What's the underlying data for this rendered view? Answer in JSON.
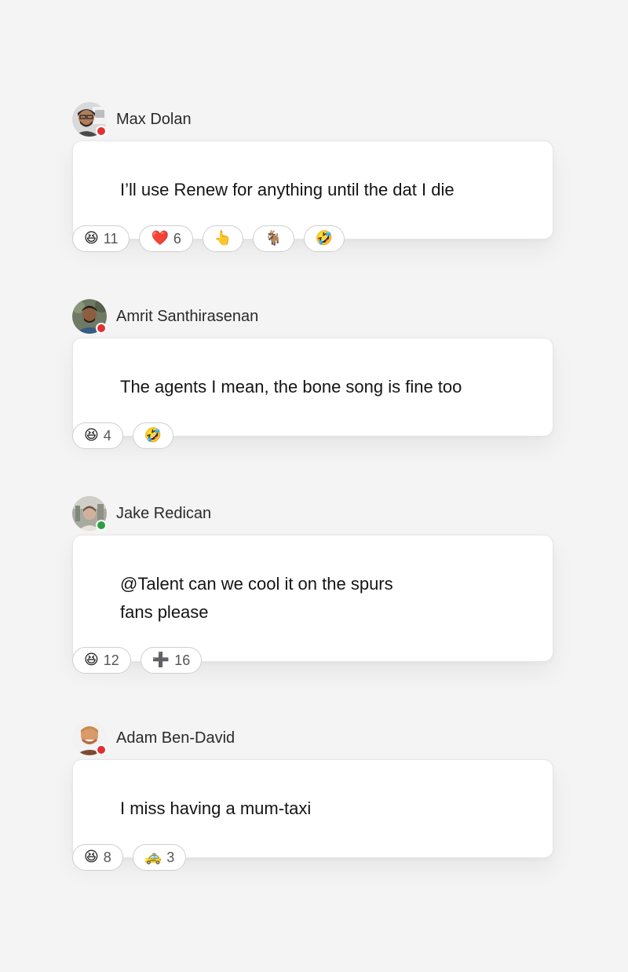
{
  "messages": [
    {
      "author": "Max Dolan",
      "status": "busy",
      "text": "I’ll use Renew for anything until the dat I die",
      "reactions": [
        {
          "emoji": "😆",
          "icon": "laughing-icon",
          "count": "11"
        },
        {
          "emoji": "❤️",
          "icon": "heart-icon",
          "count": "6"
        },
        {
          "emoji": "👆",
          "icon": "point-up-icon",
          "count": ""
        },
        {
          "emoji": "🐐",
          "icon": "goat-icon",
          "count": ""
        },
        {
          "emoji": "🤣",
          "icon": "rofl-icon",
          "count": ""
        }
      ]
    },
    {
      "author": "Amrit Santhirasenan",
      "status": "busy",
      "text": "The agents I mean, the bone song is fine too",
      "reactions": [
        {
          "emoji": "😆",
          "icon": "laughing-icon",
          "count": "4"
        },
        {
          "emoji": "🤣",
          "icon": "rofl-icon",
          "count": ""
        }
      ]
    },
    {
      "author": "Jake Redican",
      "status": "online",
      "text_lines": [
        "@Talent can we cool it on the spurs",
        "fans please"
      ],
      "reactions": [
        {
          "emoji": "😆",
          "icon": "laughing-icon",
          "count": "12"
        },
        {
          "emoji": "➕",
          "icon": "plus-icon",
          "count": "16"
        }
      ]
    },
    {
      "author": "Adam Ben-David",
      "status": "busy",
      "text": "I miss having a mum-taxi",
      "reactions": [
        {
          "emoji": "😆",
          "icon": "laughing-icon",
          "count": "8"
        },
        {
          "emoji": "🚕",
          "icon": "taxi-icon",
          "count": "3"
        }
      ]
    }
  ],
  "colors": {
    "background": "#f4f4f4",
    "bubble": "#ffffff",
    "status_busy": "#e03131",
    "status_online": "#2f9e44"
  }
}
